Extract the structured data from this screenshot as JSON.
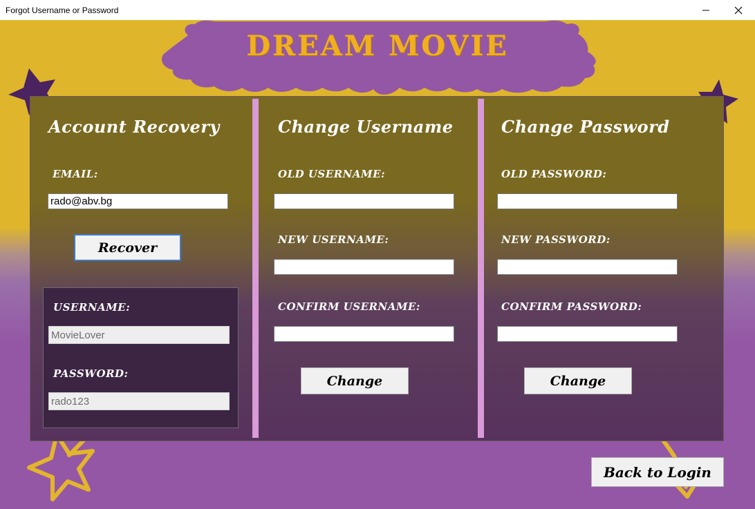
{
  "window": {
    "title": "Forgot Username or Password"
  },
  "app": {
    "name": "DREAM MOVIE"
  },
  "recovery": {
    "heading": "Account Recovery",
    "email_label": "EMAIL:",
    "email_value": "rado@abv.bg",
    "recover_button": "Recover",
    "username_label": "USERNAME:",
    "username_value": "MovieLover",
    "password_label": "PASSWORD:",
    "password_value": "rado123"
  },
  "change_username": {
    "heading": "Change Username",
    "old_label": "OLD USERNAME:",
    "new_label": "NEW USERNAME:",
    "confirm_label": "CONFIRM USERNAME:",
    "button": "Change"
  },
  "change_password": {
    "heading": "Change Password",
    "old_label": "OLD PASSWORD:",
    "new_label": "NEW PASSWORD:",
    "confirm_label": "CONFIRM PASSWORD:",
    "button": "Change"
  },
  "back_button": "Back to Login",
  "colors": {
    "gold": "#dfb62b",
    "purple": "#9457a6",
    "divider": "#d99ad8",
    "title_text": "#f0b01e"
  }
}
